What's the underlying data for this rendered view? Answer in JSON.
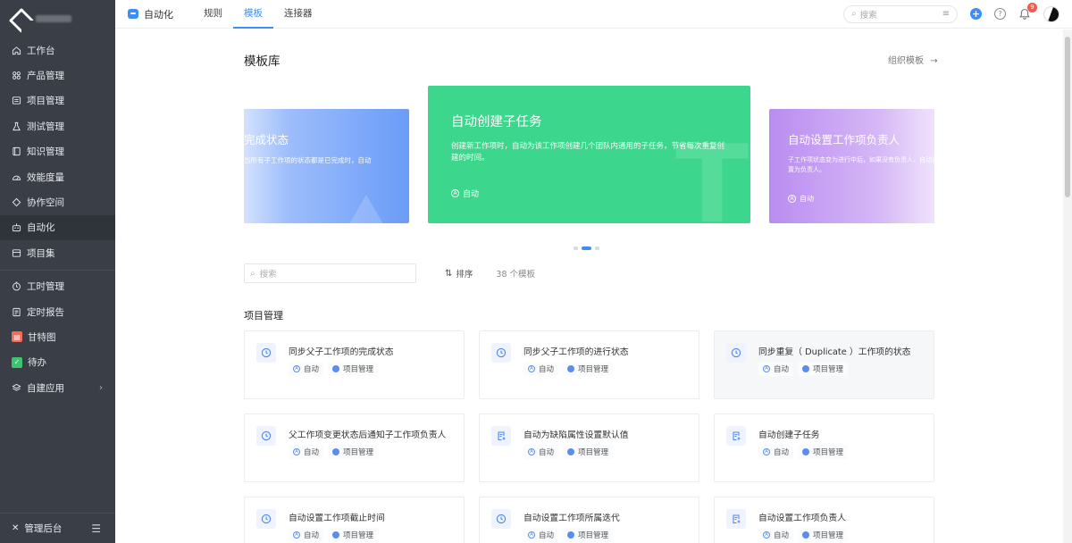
{
  "sidebar": {
    "items": [
      {
        "label": "工作台",
        "icon": "home-icon"
      },
      {
        "label": "产品管理",
        "icon": "grid-icon"
      },
      {
        "label": "项目管理",
        "icon": "folder-icon"
      },
      {
        "label": "测试管理",
        "icon": "flask-icon"
      },
      {
        "label": "知识管理",
        "icon": "book-icon"
      },
      {
        "label": "效能度量",
        "icon": "gauge-icon"
      },
      {
        "label": "协作空间",
        "icon": "diamond-icon"
      },
      {
        "label": "自动化",
        "icon": "robot-icon",
        "active": true
      },
      {
        "label": "项目集",
        "icon": "stack-icon"
      }
    ],
    "items2": [
      {
        "label": "工时管理",
        "icon": "clock-icon"
      },
      {
        "label": "定时报告",
        "icon": "report-icon"
      },
      {
        "label": "甘特图",
        "icon": "gantt-icon",
        "color": "#f26b5b"
      },
      {
        "label": "待办",
        "icon": "check-icon",
        "color": "#3cc46e"
      },
      {
        "label": "自建应用",
        "icon": "app-icon",
        "chevron": "›"
      }
    ],
    "bottom_label": "管理后台"
  },
  "topbar": {
    "app_title": "自动化",
    "tabs": [
      "规则",
      "模板",
      "连接器"
    ],
    "active_tab": "模板",
    "search_placeholder": "搜索",
    "notification_count": "9"
  },
  "main": {
    "title": "模板库",
    "org_link": "组织模板",
    "org_link_arrow": "→",
    "carousel": {
      "left": {
        "title": "完成状态",
        "desc": "当所有子工作项的状态都是已完成时，自动"
      },
      "center": {
        "title": "自动创建子任务",
        "desc": "创建新工作项时，自动为该工作项创建几个团队内通用的子任务，节省每次重复创建的时间。",
        "tag": "自动"
      },
      "right": {
        "title": "自动设置工作项负责人",
        "desc": "子工作项状态变为进行中后，如果没有负责人，自动设置为负责人。",
        "tag": "自动"
      }
    },
    "search_placeholder": "搜索",
    "sort_label": "排序",
    "count_label": "38 个模板",
    "section_title": "项目管理",
    "templates": [
      {
        "title": "同步父子工作项的完成状态",
        "icon": "clock-icon",
        "tags": [
          "自动",
          "项目管理"
        ]
      },
      {
        "title": "同步父子工作项的进行状态",
        "icon": "clock-icon",
        "tags": [
          "自动",
          "项目管理"
        ]
      },
      {
        "title": "同步重复（ Duplicate ）工作项的状态",
        "icon": "clock-icon",
        "tags": [
          "自动",
          "项目管理"
        ]
      },
      {
        "title": "父工作项变更状态后通知子工作项负责人",
        "icon": "clock-icon",
        "tags": [
          "自动",
          "项目管理"
        ]
      },
      {
        "title": "自动为缺陷属性设置默认值",
        "icon": "doc-add-icon",
        "tags": [
          "自动",
          "项目管理"
        ]
      },
      {
        "title": "自动创建子任务",
        "icon": "doc-add-icon",
        "tags": [
          "自动",
          "项目管理"
        ]
      },
      {
        "title": "自动设置工作项截止时间",
        "icon": "clock-icon",
        "tags": [
          "自动",
          "项目管理"
        ]
      },
      {
        "title": "自动设置工作项所属迭代",
        "icon": "clock-icon",
        "tags": [
          "自动",
          "项目管理"
        ]
      },
      {
        "title": "自动设置工作项负责人",
        "icon": "doc-add-icon",
        "tags": [
          "自动",
          "项目管理"
        ]
      }
    ]
  },
  "colors": {
    "accent": "#3d8ef8",
    "card_green": "#3cd68c",
    "card_purple": "#b98cf0",
    "sidebar_bg": "#3a3f47"
  }
}
